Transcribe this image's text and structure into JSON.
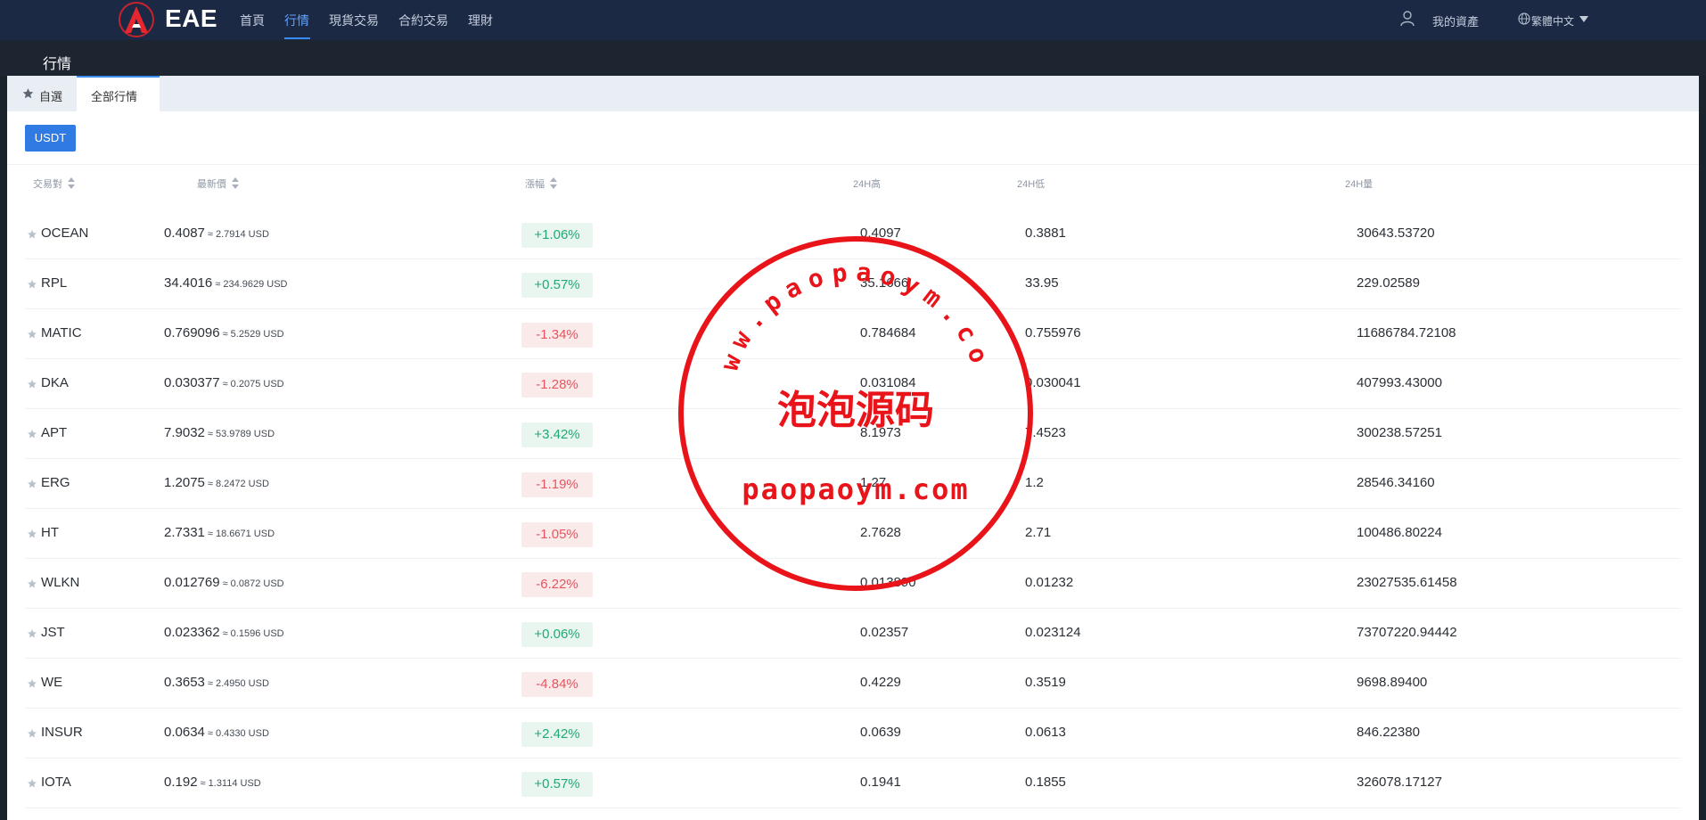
{
  "nav": {
    "brand": "EAE",
    "items": [
      {
        "label": "首頁"
      },
      {
        "label": "行情",
        "active": true
      },
      {
        "label": "現貨交易"
      },
      {
        "label": "合約交易"
      },
      {
        "label": "理財"
      }
    ],
    "assets_label": "我的資產",
    "language": "繁體中文"
  },
  "subheader": {
    "title": "行情"
  },
  "tabs": {
    "favorites": "自選",
    "all_markets": "全部行情"
  },
  "quote_filter": {
    "selected": "USDT"
  },
  "table": {
    "headers": {
      "pair": "交易對",
      "last_price": "最新價",
      "change": "漲幅",
      "high_24h": "24H高",
      "low_24h": "24H低",
      "volume_24h": "24H量"
    },
    "rows": [
      {
        "pair": "OCEAN",
        "price": "0.4087",
        "usd": "≈ 2.7914 USD",
        "change": "+1.06%",
        "dir": "up",
        "high": "0.4097",
        "low": "0.3881",
        "volume": "30643.53720"
      },
      {
        "pair": "RPL",
        "price": "34.4016",
        "usd": "≈ 234.9629 USD",
        "change": "+0.57%",
        "dir": "up",
        "high": "35.1666",
        "low": "33.95",
        "volume": "229.02589"
      },
      {
        "pair": "MATIC",
        "price": "0.769096",
        "usd": "≈ 5.2529 USD",
        "change": "-1.34%",
        "dir": "down",
        "high": "0.784684",
        "low": "0.755976",
        "volume": "11686784.72108"
      },
      {
        "pair": "DKA",
        "price": "0.030377",
        "usd": "≈ 0.2075 USD",
        "change": "-1.28%",
        "dir": "down",
        "high": "0.031084",
        "low": "0.030041",
        "volume": "407993.43000"
      },
      {
        "pair": "APT",
        "price": "7.9032",
        "usd": "≈ 53.9789 USD",
        "change": "+3.42%",
        "dir": "up",
        "high": "8.1973",
        "low": "7.4523",
        "volume": "300238.57251"
      },
      {
        "pair": "ERG",
        "price": "1.2075",
        "usd": "≈ 8.2472 USD",
        "change": "-1.19%",
        "dir": "down",
        "high": "1.27",
        "low": "1.2",
        "volume": "28546.34160"
      },
      {
        "pair": "HT",
        "price": "2.7331",
        "usd": "≈ 18.6671 USD",
        "change": "-1.05%",
        "dir": "down",
        "high": "2.7628",
        "low": "2.71",
        "volume": "100486.80224"
      },
      {
        "pair": "WLKN",
        "price": "0.012769",
        "usd": "≈ 0.0872 USD",
        "change": "-6.22%",
        "dir": "down",
        "high": "0.013890",
        "low": "0.01232",
        "volume": "23027535.61458"
      },
      {
        "pair": "JST",
        "price": "0.023362",
        "usd": "≈ 0.1596 USD",
        "change": "+0.06%",
        "dir": "up",
        "high": "0.02357",
        "low": "0.023124",
        "volume": "73707220.94442"
      },
      {
        "pair": "WE",
        "price": "0.3653",
        "usd": "≈ 2.4950 USD",
        "change": "-4.84%",
        "dir": "down",
        "high": "0.4229",
        "low": "0.3519",
        "volume": "9698.89400"
      },
      {
        "pair": "INSUR",
        "price": "0.0634",
        "usd": "≈ 0.4330 USD",
        "change": "+2.42%",
        "dir": "up",
        "high": "0.0639",
        "low": "0.0613",
        "volume": "846.22380"
      },
      {
        "pair": "IOTA",
        "price": "0.192",
        "usd": "≈ 1.3114 USD",
        "change": "+0.57%",
        "dir": "up",
        "high": "0.1941",
        "low": "0.1855",
        "volume": "326078.17127"
      }
    ]
  },
  "watermark": {
    "top_arc": "www.paopaoym.com",
    "center": "泡泡源码",
    "bottom": "paopaoym.com"
  },
  "colors": {
    "nav_bg": "#1b2945",
    "accent": "#2f7be3",
    "up": "#22a874",
    "down": "#e5565f",
    "watermark": "#e8141a"
  }
}
